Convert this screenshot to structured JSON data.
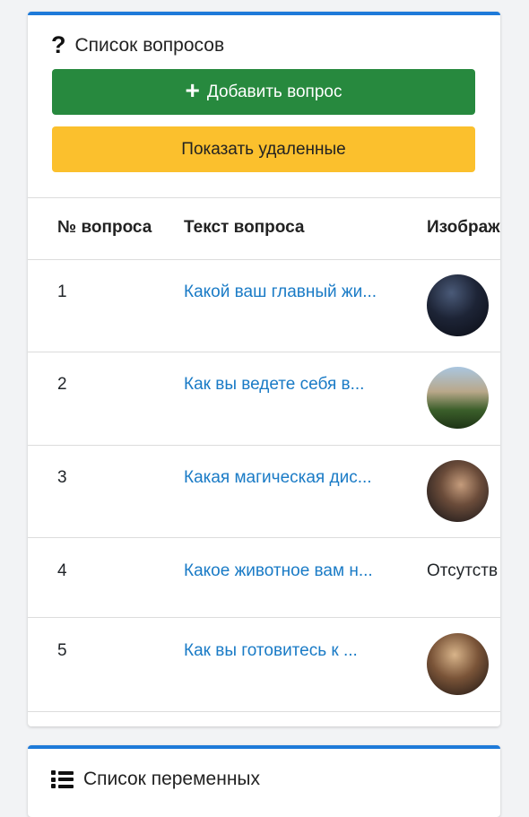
{
  "questions_card": {
    "title": "Список вопросов",
    "add_button": "Добавить вопрос",
    "show_deleted_button": "Показать удаленные",
    "table": {
      "headers": [
        "№ вопроса",
        "Текст вопроса",
        "Изображ"
      ],
      "rows": [
        {
          "num": "1",
          "text": "Какой ваш главный жи...",
          "image": "thumbnail"
        },
        {
          "num": "2",
          "text": "Как вы ведете себя в...",
          "image": "thumbnail"
        },
        {
          "num": "3",
          "text": "Какая магическая дис...",
          "image": "thumbnail"
        },
        {
          "num": "4",
          "text": "Какое животное вам н...",
          "image_text": "Отсутств"
        },
        {
          "num": "5",
          "text": "Как вы готовитесь к ...",
          "image": "thumbnail"
        }
      ]
    }
  },
  "variables_card": {
    "title": "Список переменных"
  },
  "icons": {
    "questions": "question-mark-icon",
    "add": "plus-icon",
    "variables": "list-icon"
  },
  "colors": {
    "accent": "#1e7ad9",
    "add_button": "#27893e",
    "deleted_button": "#fbc02d",
    "link": "#1a7bc6"
  }
}
